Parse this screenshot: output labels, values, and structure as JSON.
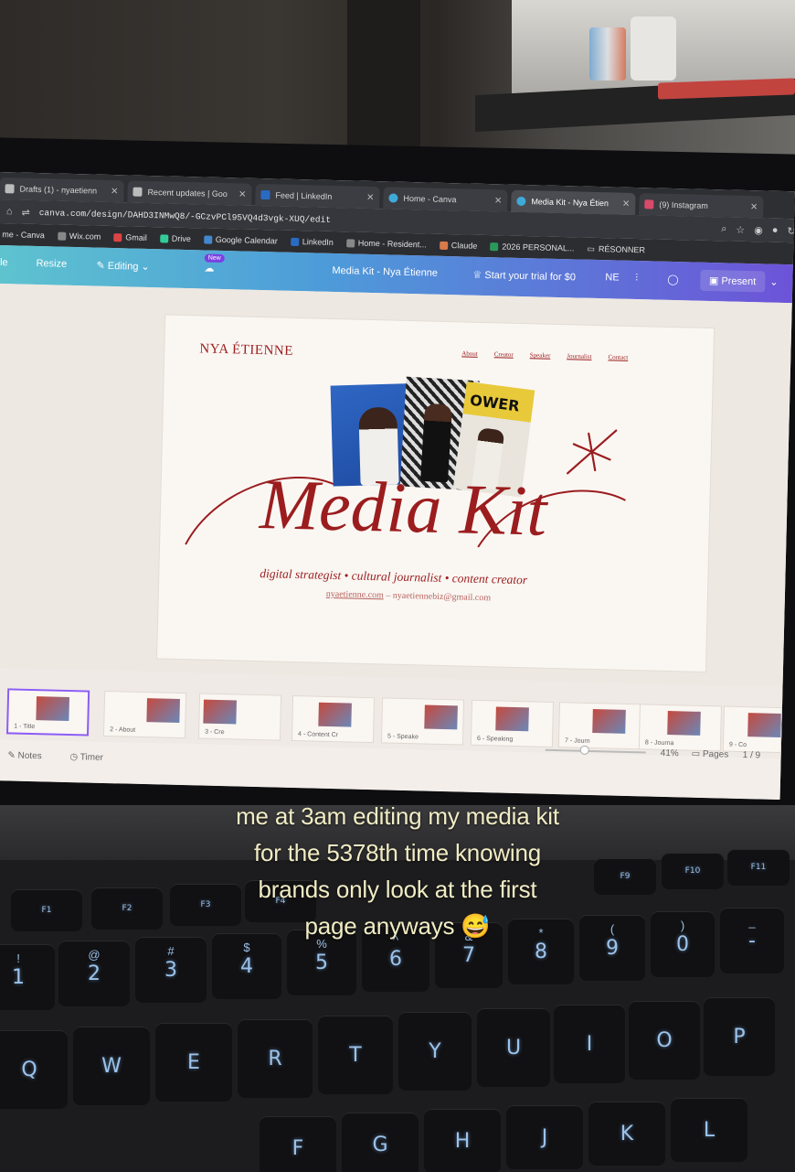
{
  "browser": {
    "tabs": [
      {
        "label": "Drafts (1) - nyaetienn",
        "active": false
      },
      {
        "label": "Recent updates | Goo",
        "active": false
      },
      {
        "label": "Feed | LinkedIn",
        "active": false
      },
      {
        "label": "Home - Canva",
        "active": false
      },
      {
        "label": "Media Kit - Nya Étien",
        "active": true
      },
      {
        "label": "(9) Instagram",
        "active": false
      }
    ],
    "url": "canva.com/design/DAHD3INMwQ8/-GCzvPCl95VQ4d3vgk-XUQ/edit",
    "bookmarks": [
      "me - Canva",
      "Wix.com",
      "Gmail",
      "Drive",
      "Google Calendar",
      "LinkedIn",
      "Home - Resident...",
      "Claude",
      "2026 PERSONAL...",
      "RÉSONNER"
    ]
  },
  "canva": {
    "file_label": "ile",
    "resize_label": "Resize",
    "editing_label": "Editing",
    "new_badge": "New",
    "doc_title": "Media Kit - Nya Étienne",
    "trial_label": "Start your trial for $0",
    "avatar_initials": "NE",
    "present_label": "Present"
  },
  "slide": {
    "brand": "NYA ÉTIENNE",
    "nav": [
      "About",
      "Creator",
      "Speaker",
      "Journalist",
      "Contact"
    ],
    "photo3_text": "OWER",
    "headline": "Media Kit",
    "taglines": "digital strategist • cultural journalist • content creator",
    "website": "nyaetienne.com",
    "separator": " – ",
    "email": "nyaetiennebiz@gmail.com"
  },
  "thumbnails": [
    {
      "label": "1 - Title"
    },
    {
      "label": "2 - About"
    },
    {
      "label": "3 - Cre"
    },
    {
      "label": "4 - Content Cr"
    },
    {
      "label": "5 - Speake"
    },
    {
      "label": "6 - Speaking"
    },
    {
      "label": "7 - Journ"
    },
    {
      "label": "8 - Journa"
    },
    {
      "label": "9 - Co"
    }
  ],
  "footer": {
    "notes_label": "Notes",
    "timer_label": "Timer",
    "zoom": "41%",
    "pages_label": "Pages",
    "page_count": "1 / 9"
  },
  "caption": [
    "me at 3am editing my media kit",
    "for the 5378th time knowing",
    "brands only look at the first",
    "page anyways 😅"
  ],
  "keyboard": {
    "fn_row": [
      "F1",
      "F2",
      "F3",
      "F4",
      "F9",
      "F10",
      "F11"
    ],
    "number_row": [
      {
        "main": "1",
        "shift": "!"
      },
      {
        "main": "2",
        "shift": "@"
      },
      {
        "main": "3",
        "shift": "#"
      },
      {
        "main": "4",
        "shift": "$"
      },
      {
        "main": "5",
        "shift": "%"
      },
      {
        "main": "6",
        "shift": "^"
      },
      {
        "main": "7",
        "shift": "&"
      },
      {
        "main": "8",
        "shift": "*"
      },
      {
        "main": "9",
        "shift": "("
      },
      {
        "main": "0",
        "shift": ")"
      },
      {
        "main": "-",
        "shift": "_"
      }
    ],
    "qwerty_row": [
      "Q",
      "W",
      "E",
      "R",
      "T",
      "Y",
      "U",
      "I",
      "O",
      "P"
    ],
    "home_row": [
      "F",
      "G",
      "H",
      "J",
      "K",
      "L"
    ]
  },
  "colors": {
    "brand_red": "#9b1d1e",
    "caption_yellow": "#f1ecc4",
    "key_backlight": "#9cc3ea"
  }
}
